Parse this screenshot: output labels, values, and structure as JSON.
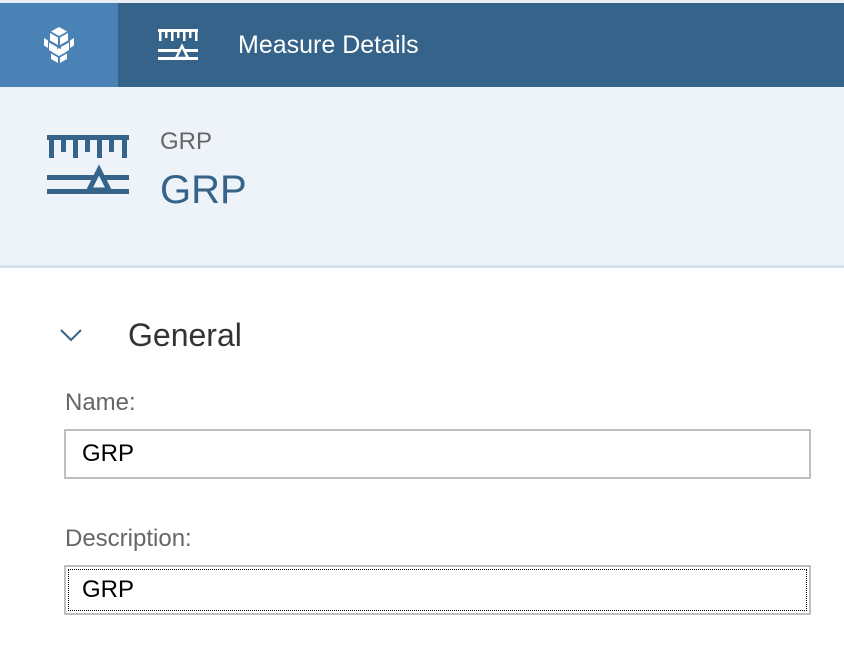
{
  "shell": {
    "title": "Measure Details",
    "home_icon": "product-cube-icon",
    "app_icon": "measure-ruler-icon"
  },
  "header": {
    "subtitle": "GRP",
    "title": "GRP",
    "icon": "measure-ruler-icon"
  },
  "section": {
    "title": "General",
    "toggle_icon": "chevron-down-icon"
  },
  "fields": {
    "name": {
      "label": "Name:",
      "value": "GRP"
    },
    "description": {
      "label": "Description:",
      "value": "GRP"
    }
  },
  "colors": {
    "shell_bg": "#35638a",
    "home_bg": "#4a82b5",
    "header_bg": "#edf3f8",
    "accent": "#35638a"
  }
}
